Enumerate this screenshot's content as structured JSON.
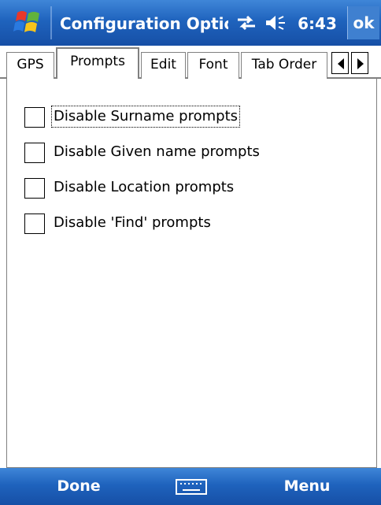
{
  "titlebar": {
    "title": "Configuration Options",
    "time": "6:43",
    "ok_label": "ok",
    "icons": [
      "windows-start-icon",
      "connectivity-icon",
      "volume-icon"
    ]
  },
  "tabs": [
    {
      "label": "GPS",
      "selected": false
    },
    {
      "label": "Prompts",
      "selected": true
    },
    {
      "label": "Edit",
      "selected": false
    },
    {
      "label": "Font",
      "selected": false
    },
    {
      "label": "Tab Order",
      "selected": false
    }
  ],
  "tab_scroll": {
    "left_icon": "arrow-left-icon",
    "right_icon": "arrow-right-icon"
  },
  "options": [
    {
      "label": "Disable Surname prompts",
      "checked": false,
      "focused": true
    },
    {
      "label": "Disable Given name prompts",
      "checked": false,
      "focused": false
    },
    {
      "label": "Disable Location prompts",
      "checked": false,
      "focused": false
    },
    {
      "label": "Disable 'Find' prompts",
      "checked": false,
      "focused": false
    }
  ],
  "menubar": {
    "left_softkey": "Done",
    "right_softkey": "Menu",
    "center_icon": "keyboard-icon"
  },
  "colors": {
    "bar_blue": "#1f63bd",
    "bar_highlight": "#3f86d8",
    "border_gray": "#808080"
  }
}
